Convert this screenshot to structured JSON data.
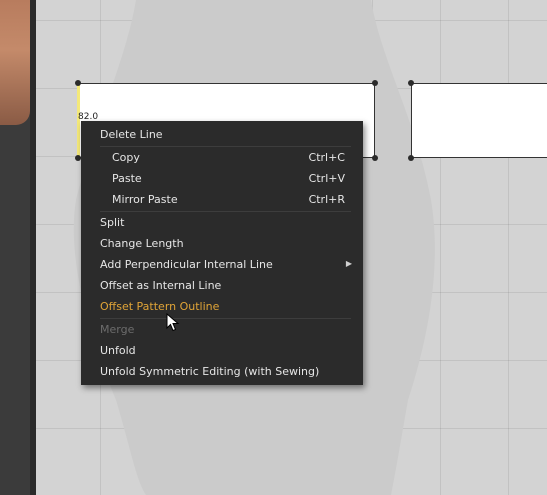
{
  "measurement_label": "82.0",
  "context_menu": {
    "items": [
      {
        "label": "Delete Line",
        "shortcut": ""
      },
      {
        "label": "Copy",
        "shortcut": "Ctrl+C"
      },
      {
        "label": "Paste",
        "shortcut": "Ctrl+V"
      },
      {
        "label": "Mirror Paste",
        "shortcut": "Ctrl+R"
      },
      {
        "label": "Split",
        "shortcut": ""
      },
      {
        "label": "Change Length",
        "shortcut": ""
      },
      {
        "label": "Add Perpendicular Internal Line",
        "shortcut": "",
        "submenu_icon": "chevron-right-icon"
      },
      {
        "label": "Offset as Internal Line",
        "shortcut": ""
      },
      {
        "label": "Offset Pattern Outline",
        "shortcut": "",
        "state": "highlighted"
      },
      {
        "label": "Merge",
        "shortcut": "",
        "state": "disabled"
      },
      {
        "label": "Unfold",
        "shortcut": ""
      },
      {
        "label": "Unfold Symmetric Editing (with Sewing)",
        "shortcut": ""
      }
    ]
  },
  "colors": {
    "menu_background": "#2b2b2b",
    "menu_text": "#e6e6e6",
    "highlight_text": "#e0a437",
    "disabled_text": "#6c6c6c",
    "canvas": "#d3d3d3",
    "selected_line": "#f4e97a"
  }
}
